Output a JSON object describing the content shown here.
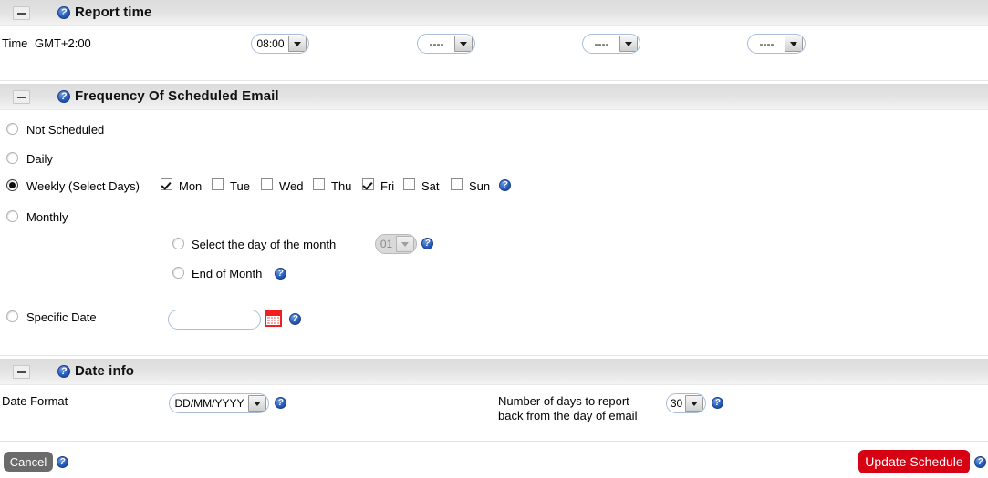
{
  "sections": {
    "report_time": {
      "title": "Report time",
      "time_label": "Time",
      "timezone": "GMT+2:00",
      "dropdowns": [
        {
          "name": "time-slot-1",
          "value": "08:00"
        },
        {
          "name": "time-slot-2",
          "value": "----"
        },
        {
          "name": "time-slot-3",
          "value": "----"
        },
        {
          "name": "time-slot-4",
          "value": "----"
        }
      ]
    },
    "frequency": {
      "title": "Frequency Of Scheduled Email",
      "options": {
        "not_scheduled": "Not Scheduled",
        "daily": "Daily",
        "weekly": "Weekly (Select Days)",
        "monthly": "Monthly",
        "specific_date": "Specific Date"
      },
      "days": [
        {
          "label": "Mon",
          "checked": true
        },
        {
          "label": "Tue",
          "checked": false
        },
        {
          "label": "Wed",
          "checked": false
        },
        {
          "label": "Thu",
          "checked": false
        },
        {
          "label": "Fri",
          "checked": true
        },
        {
          "label": "Sat",
          "checked": false
        },
        {
          "label": "Sun",
          "checked": false
        }
      ],
      "monthly_sub": {
        "select_day_label": "Select the day of the month",
        "day_value": "01",
        "end_of_month_label": "End of Month"
      },
      "specific_date_value": ""
    },
    "date_info": {
      "title": "Date info",
      "date_format_label": "Date Format",
      "date_format_value": "DD/MM/YYYY",
      "days_back_label_line1": "Number of days to report",
      "days_back_label_line2": "back from the day of email",
      "days_back_value": "30"
    }
  },
  "footer": {
    "cancel_label": "Cancel",
    "update_label": "Update Schedule"
  },
  "colors": {
    "update_button": "#d60112",
    "cancel_button": "#6b6b6b",
    "calendar_icon": "#f02020",
    "help_icon": "#2a5fc0"
  },
  "icons": {
    "help": "help-icon",
    "collapse": "minus-icon",
    "calendar": "calendar-icon",
    "dropdown_arrow": "chevron-down-icon"
  }
}
